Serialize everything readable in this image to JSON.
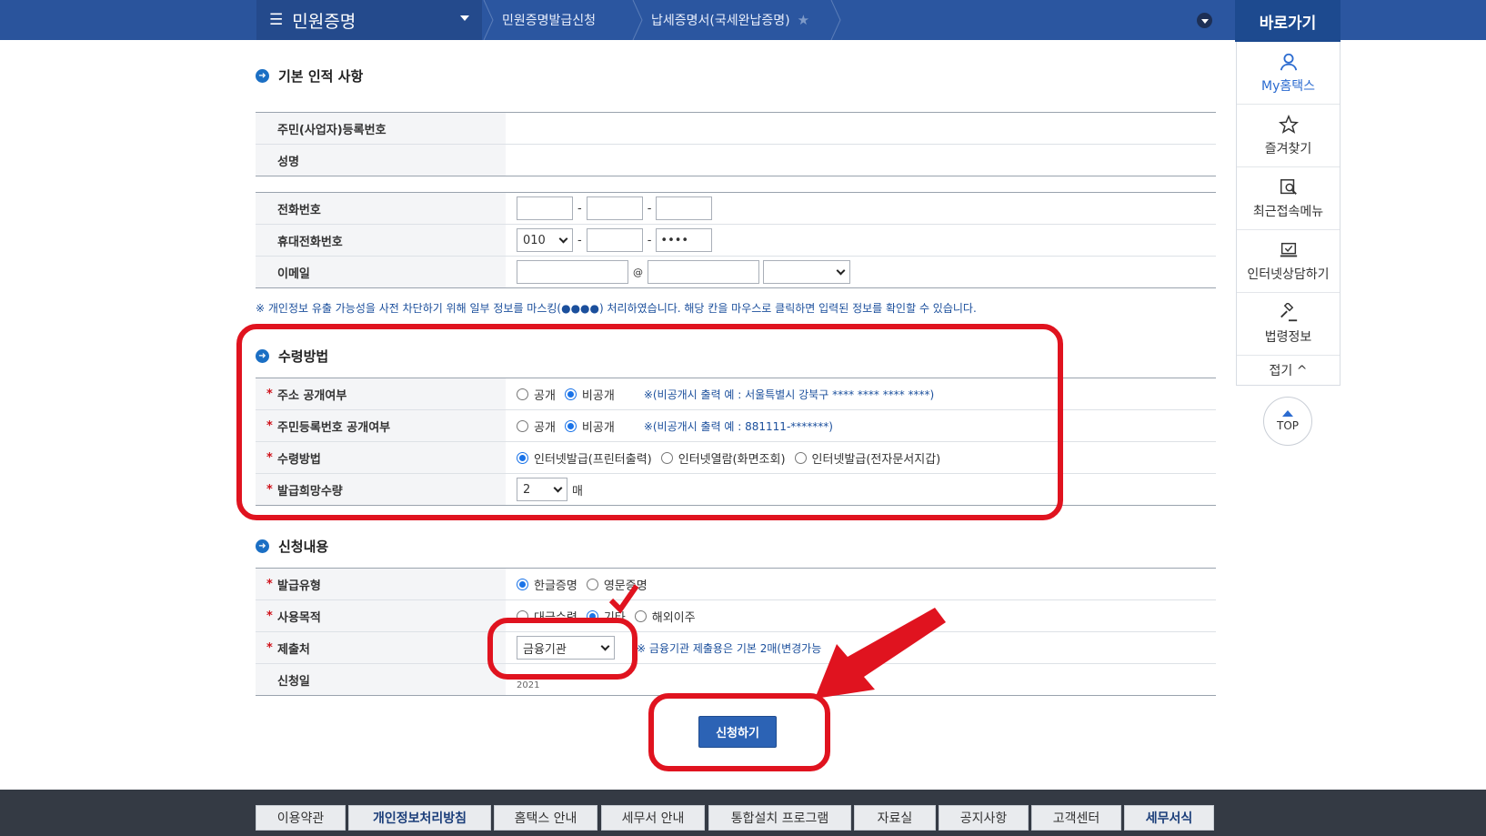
{
  "topbar": {
    "menu_label": "민원증명",
    "breadcrumb": [
      "민원증명발급신청",
      "납세증명서(국세완납증명)"
    ],
    "shortcut_title": "바로가기"
  },
  "quick_panel": {
    "items": [
      {
        "label": "My홈택스",
        "icon": "user-icon"
      },
      {
        "label": "즐겨찾기",
        "icon": "star-icon"
      },
      {
        "label": "최근접속메뉴",
        "icon": "recent-search-icon"
      },
      {
        "label": "인터넷상담하기",
        "icon": "laptop-check-icon"
      },
      {
        "label": "법령정보",
        "icon": "gavel-icon"
      }
    ],
    "fold_label": "접기 ^",
    "top_label": "TOP"
  },
  "basic": {
    "title": "기본 인적 사항",
    "rows": [
      {
        "label": "주민(사업자)등록번호",
        "value": ""
      },
      {
        "label": "성명",
        "value": ""
      }
    ]
  },
  "contact": {
    "phone_label": "전화번호",
    "mobile_label": "휴대전화번호",
    "mobile_prefix": "010",
    "mobile_last": "••••",
    "email_label": "이메일",
    "email_at": "@"
  },
  "notice": "※ 개인정보 유출 가능성을 사전 차단하기 위해 일부 정보를 마스킹(●●●●) 처리하였습니다. 해당 칸을 마우스로 클릭하면 입력된 정보를 확인할 수 있습니다.",
  "receive": {
    "title": "수령방법",
    "address_label": "주소 공개여부",
    "address_options": [
      "공개",
      "비공개"
    ],
    "address_note": "※(비공개시 출력 예 : 서울특별시 강북구 **** **** **** ****)",
    "rrn_label": "주민등록번호 공개여부",
    "rrn_options": [
      "공개",
      "비공개"
    ],
    "rrn_note": "※(비공개시 출력 예 : 881111-*******)",
    "method_label": "수령방법",
    "method_options": [
      "인터넷발급(프린터출력)",
      "인터넷열람(화면조회)",
      "인터넷발급(전자문서지갑)"
    ],
    "qty_label": "발급희망수량",
    "qty_value": "2",
    "qty_unit": "매"
  },
  "apply": {
    "title": "신청내용",
    "type_label": "발급유형",
    "type_options": [
      "한글증명",
      "영문증명"
    ],
    "purpose_label": "사용목적",
    "purpose_options": [
      "대금수령",
      "기타",
      "해외이주"
    ],
    "submit_to_label": "제출처",
    "submit_to_value": "금융기관",
    "submit_to_note": "※ 금융기관 제출용은 기본 2매(변경가능",
    "date_label": "신청일",
    "date_value": "2021"
  },
  "submit_label": "신청하기",
  "footer_tabs": [
    "이용약관",
    "개인정보처리방침",
    "홈택스 안내",
    "세무서 안내",
    "통합설치 프로그램",
    "자료실",
    "공지사항",
    "고객센터",
    "세무서식"
  ],
  "colors": {
    "brand_blue": "#2b56a0",
    "annotation_red": "#e0131f",
    "submit_blue": "#2c63b5"
  }
}
